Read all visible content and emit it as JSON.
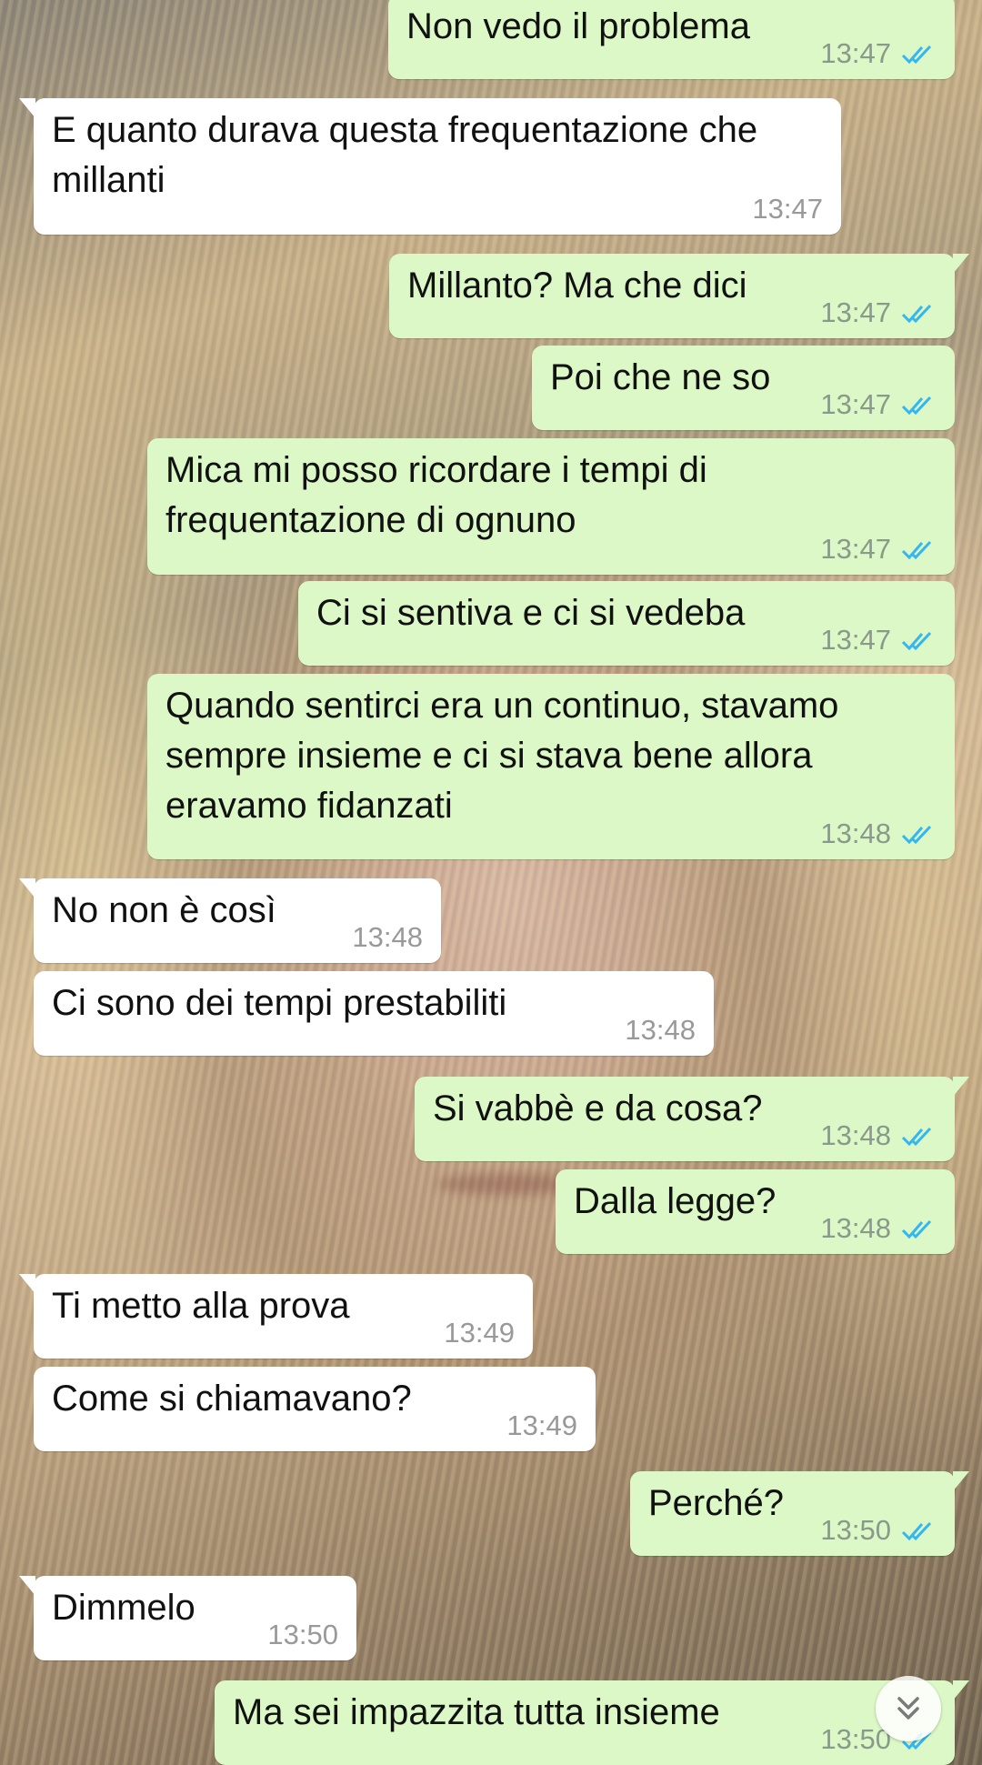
{
  "colors": {
    "outgoing_bubble": "#dcf8c6",
    "incoming_bubble": "#ffffff",
    "read_ticks": "#34b7f1"
  },
  "messages": [
    {
      "dir": "out",
      "text": "Non vedo il problema",
      "time": "13:47",
      "status": "read"
    },
    {
      "dir": "in",
      "text": "E quanto durava questa frequentazione che millanti",
      "time": "13:47"
    },
    {
      "dir": "out",
      "text": "Millanto? Ma che dici",
      "time": "13:47",
      "status": "read"
    },
    {
      "dir": "out",
      "text": "Poi che ne so",
      "time": "13:47",
      "status": "read"
    },
    {
      "dir": "out",
      "text": "Mica mi posso ricordare i tempi di frequentazione di ognuno",
      "time": "13:47",
      "status": "read"
    },
    {
      "dir": "out",
      "text": "Ci si sentiva e ci si vedeba",
      "time": "13:47",
      "status": "read"
    },
    {
      "dir": "out",
      "text": "Quando sentirci era un continuo, stavamo sempre insieme e ci si stava bene allora eravamo fidanzati",
      "time": "13:48",
      "status": "read"
    },
    {
      "dir": "in",
      "text": "No non è così",
      "time": "13:48"
    },
    {
      "dir": "in",
      "text": "Ci sono dei tempi prestabiliti",
      "time": "13:48"
    },
    {
      "dir": "out",
      "text": "Si vabbè e da cosa?",
      "time": "13:48",
      "status": "read"
    },
    {
      "dir": "out",
      "text": "Dalla legge?",
      "time": "13:48",
      "status": "read"
    },
    {
      "dir": "in",
      "text": "Ti metto alla prova",
      "time": "13:49"
    },
    {
      "dir": "in",
      "text": "Come si chiamavano?",
      "time": "13:49"
    },
    {
      "dir": "out",
      "text": "Perché?",
      "time": "13:50",
      "status": "read"
    },
    {
      "dir": "in",
      "text": "Dimmelo",
      "time": "13:50"
    },
    {
      "dir": "out",
      "text": "Ma sei impazzita tutta insieme",
      "time": "13:50",
      "status": "read"
    }
  ],
  "scroll_button_icon": "double-chevron-down-icon"
}
